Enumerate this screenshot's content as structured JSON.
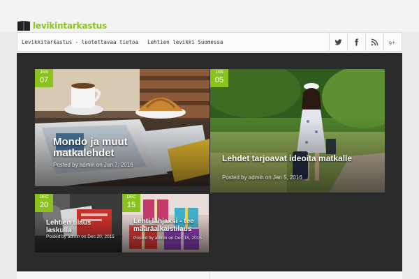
{
  "site": {
    "logo_text": "levikintarkastus"
  },
  "nav": {
    "items": [
      "Levikkitarkastus - luotettavaa tietoa",
      "Lehtien levikki Suomessa"
    ]
  },
  "social": [
    "twitter-icon",
    "facebook-icon",
    "rss-icon",
    "google-plus-icon"
  ],
  "colors": {
    "accent": "#8cc21f",
    "panel": "#2a2a2a"
  },
  "posts": [
    {
      "month": "JAN",
      "day": "07",
      "title": "Mondo ja muut matkalehdet",
      "meta": "Posted by admin on Jan 7, 2016"
    },
    {
      "month": "JAN",
      "day": "05",
      "title": "Lehdet tarjoavat ideoita matkalle",
      "meta": "Posted by admin on Jan 5, 2016"
    },
    {
      "month": "DEC",
      "day": "20",
      "title": "Lehtien tilaus laskulla",
      "meta": "Posted by admin on Dec 20, 2015"
    },
    {
      "month": "DEC",
      "day": "15",
      "title": "Lehti lahjaksi - tee määräaikaistilaus",
      "meta": "Posted by admin on Dec 15, 2015"
    }
  ]
}
